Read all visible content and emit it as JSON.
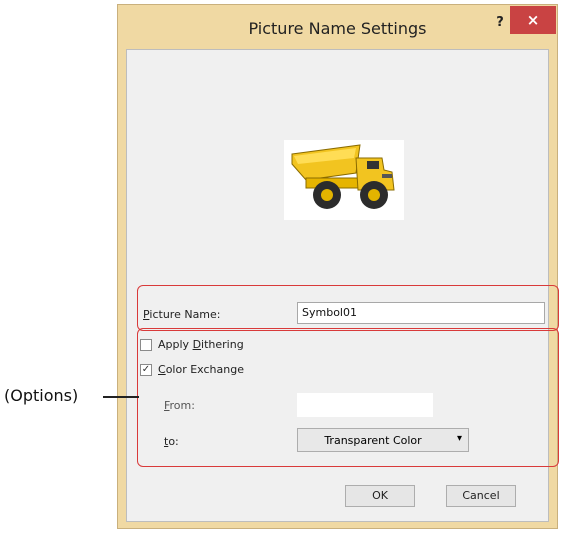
{
  "dialog": {
    "title": "Picture Name Settings",
    "help_label": "?",
    "close_label": "×"
  },
  "picture_name": {
    "label_prefix": "",
    "label_accel": "P",
    "label_rest": "icture Name:",
    "value": "Symbol01"
  },
  "options": {
    "apply_dithering": {
      "prefix": "Apply ",
      "accel": "D",
      "rest": "ithering",
      "checked": false
    },
    "color_exchange": {
      "prefix": "",
      "accel": "C",
      "rest": "olor Exchange",
      "checked": true
    },
    "from": {
      "accel": "F",
      "rest": "rom:",
      "value": ""
    },
    "to": {
      "accel": "t",
      "rest": "o:",
      "selected": "Transparent Color"
    }
  },
  "buttons": {
    "ok": "OK",
    "cancel": "Cancel"
  },
  "annotation": {
    "label": "(Options)"
  },
  "colors": {
    "frame": "#f0d9a3",
    "close": "#c94343",
    "highlight": "#d93a3a",
    "truck_yellow": "#f2c420"
  },
  "icons": {
    "preview": "dump-truck-icon",
    "dropdown": "chevron-down-icon"
  }
}
